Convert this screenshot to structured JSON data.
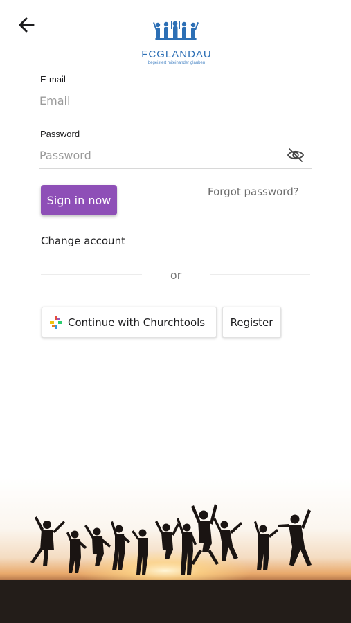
{
  "header": {
    "back_icon": "arrow-left-icon",
    "logo": {
      "name": "FCGLANDAU",
      "tagline": "begeistert miteinander glauben",
      "color": "#2c6fb5"
    }
  },
  "form": {
    "email": {
      "label": "E-mail",
      "placeholder": "Email",
      "value": ""
    },
    "password": {
      "label": "Password",
      "placeholder": "Password",
      "value": "",
      "visibility_icon": "eye-off-icon"
    },
    "sign_in_label": "Sign in now",
    "forgot_password_label": "Forgot password?",
    "change_account_label": "Change account"
  },
  "separator": {
    "label": "or"
  },
  "alternatives": {
    "churchtools_label": "Continue with Churchtools",
    "churchtools_icon": "churchtools-cross-icon",
    "register_label": "Register"
  },
  "colors": {
    "accent": "#8e4fb7",
    "logo": "#2c6fb5"
  }
}
